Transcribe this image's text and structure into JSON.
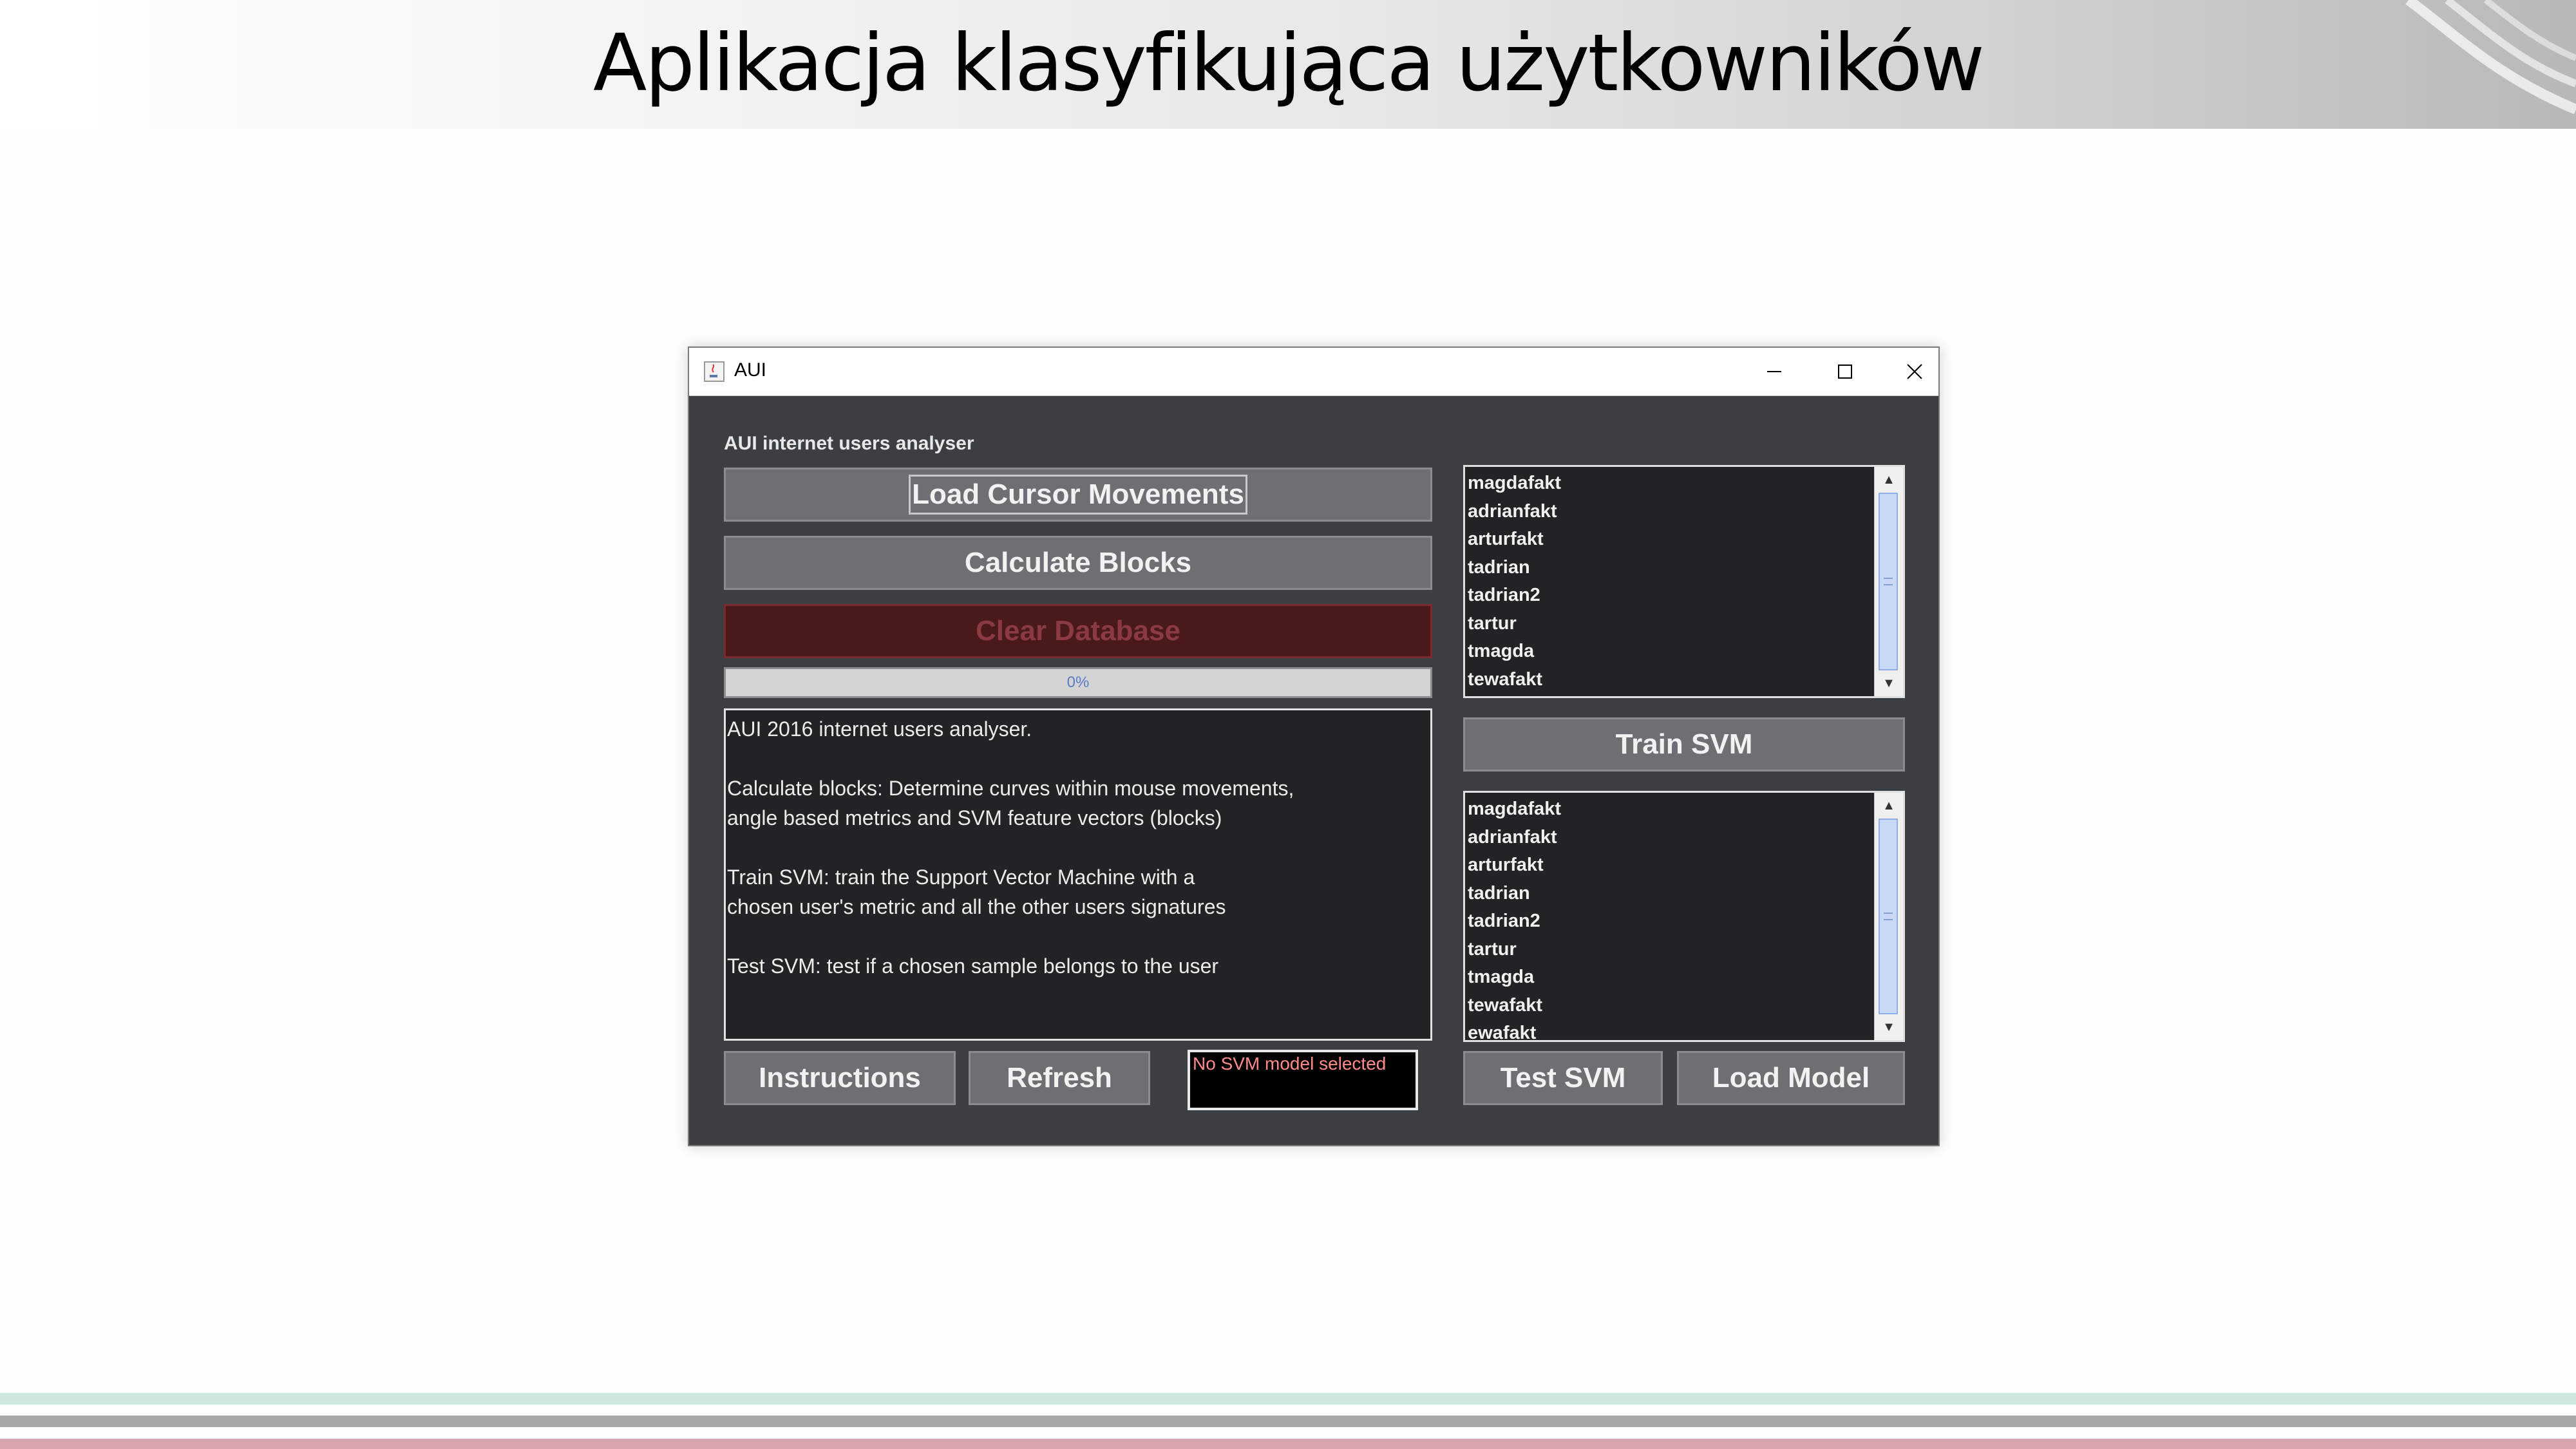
{
  "slide": {
    "title": "Aplikacja klasyfikująca użytkowników"
  },
  "window": {
    "title": "AUI",
    "controls": [
      "minimize",
      "maximize",
      "close"
    ]
  },
  "app": {
    "heading": "AUI internet users analyser",
    "buttons": {
      "load_cursor": "Load Cursor Movements",
      "calculate_blocks": "Calculate Blocks",
      "clear_database": "Clear Database",
      "train_svm": "Train SVM",
      "instructions": "Instructions",
      "refresh": "Refresh",
      "test_svm": "Test SVM",
      "load_model": "Load Model"
    },
    "progress": {
      "value": 0,
      "label": "0%"
    },
    "description_text": "AUI 2016 internet users analyser.\n\nCalculate blocks: Determine curves within mouse movements,\nangle based metrics and SVM feature vectors (blocks)\n\nTrain SVM: train the Support Vector Machine with a\nchosen user's metric and all the other users signatures\n\nTest SVM: test if a chosen sample belongs to the user",
    "model_status": "No SVM model selected",
    "users_list_top": [
      "magdafakt",
      "adrianfakt",
      "arturfakt",
      "tadrian",
      "tadrian2",
      "tartur",
      "tmagda",
      "tewafakt"
    ],
    "users_list_bottom": [
      "magdafakt",
      "adrianfakt",
      "arturfakt",
      "tadrian",
      "tadrian2",
      "tartur",
      "tmagda",
      "tewafakt",
      "ewafakt"
    ]
  },
  "colors": {
    "window_bg": "#3c3f41",
    "button_bg": "#6d6f72",
    "danger_bg": "#4a1a1a",
    "danger_text": "#8a3a40",
    "status_text": "#ff8a8a",
    "progress_text": "#5a7ac8"
  }
}
